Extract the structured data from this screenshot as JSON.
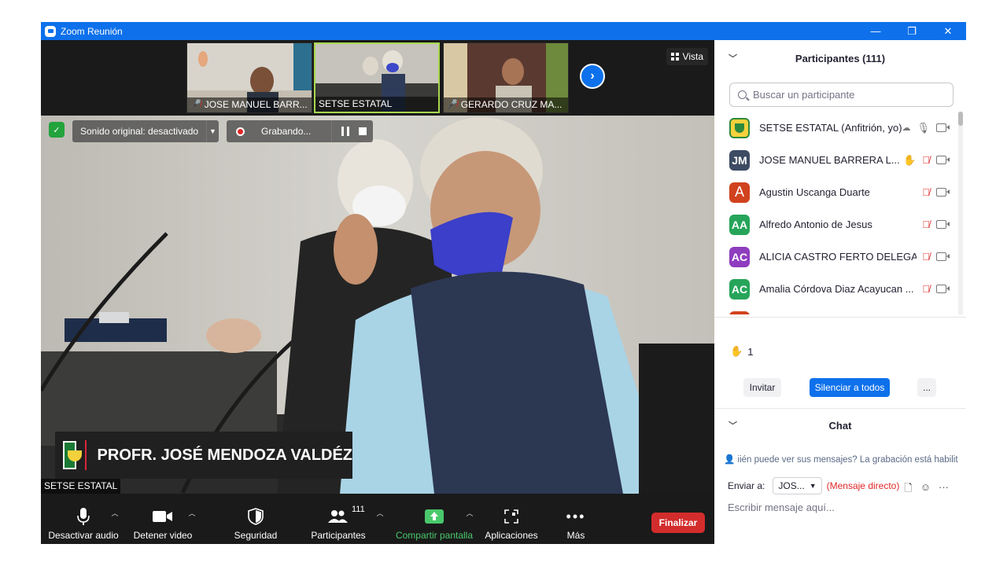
{
  "window": {
    "title": "Zoom Reunión",
    "minimize": "—",
    "restore": "❐",
    "close": "✕"
  },
  "gallery": {
    "thumbnails": [
      {
        "name": "JOSE MANUEL BARR...",
        "muted": true
      },
      {
        "name": "SETSE ESTATAL",
        "muted": false,
        "active": true
      },
      {
        "name": "GERARDO CRUZ MA...",
        "muted": true
      }
    ],
    "next_icon": "›",
    "view_label": "Vista"
  },
  "video": {
    "original_sound": "Sonido original: desactivado",
    "recording": "Grabando...",
    "speaker_caption": "PROFR. JOSÉ MENDOZA VALDÉZ",
    "speaker_tag": "SETSE ESTATAL"
  },
  "toolbar": {
    "mute": "Desactivar audio",
    "stop_video": "Detener video",
    "security": "Seguridad",
    "participants": "Participantes",
    "participants_count": "111",
    "share": "Compartir pantalla",
    "apps": "Aplicaciones",
    "more": "Más",
    "end": "Finalizar"
  },
  "panel": {
    "title": "Participantes (111)",
    "search_placeholder": "Buscar un participante",
    "participants": [
      {
        "initials": "",
        "name": "SETSE ESTATAL (Anfitrión, yo)",
        "color": "#2d8a3e",
        "hand": false,
        "mic": "on"
      },
      {
        "initials": "JM",
        "name": "JOSE MANUEL BARRERA L...",
        "color": "#3d4b63",
        "hand": true,
        "mic": "off"
      },
      {
        "initials": "A",
        "name": "Agustin Uscanga Duarte",
        "color": "#d1421e",
        "hand": false,
        "mic": "off"
      },
      {
        "initials": "AA",
        "name": "Alfredo Antonio de Jesus",
        "color": "#26a55a",
        "hand": false,
        "mic": "off"
      },
      {
        "initials": "AC",
        "name": "ALICIA CASTRO FERTO DELEGAC...",
        "color": "#8e3dbf",
        "hand": false,
        "mic": "off"
      },
      {
        "initials": "AC",
        "name": "Amalia Córdova Diaz Acayucan ...",
        "color": "#26a55a",
        "hand": false,
        "mic": "off"
      }
    ],
    "hand_count": "1",
    "invite": "Invitar",
    "mute_all": "Silenciar a todos",
    "more": "...",
    "chat_title": "Chat",
    "chat_notice": "iién puede ver sus mensajes? La grabación está habilit",
    "send_to_label": "Enviar a:",
    "send_to_value": "JOS...",
    "direct_message": "(Mensaje directo)",
    "chat_placeholder": "Escribir mensaje aquí..."
  }
}
